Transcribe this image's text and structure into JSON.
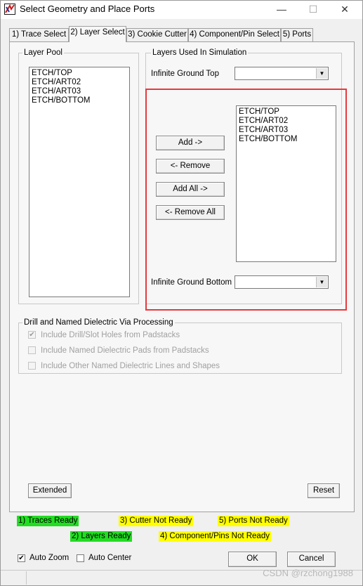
{
  "window": {
    "title": "Select Geometry and Place Ports"
  },
  "titlebar_buttons": {
    "minimize": "—",
    "maximize": "☐",
    "close": "✕"
  },
  "tabs": [
    {
      "label": "1) Trace Select"
    },
    {
      "label": "2) Layer Select"
    },
    {
      "label": "3) Cookie Cutter"
    },
    {
      "label": "4) Component/Pin Select"
    },
    {
      "label": "5) Ports"
    }
  ],
  "layer_pool": {
    "label": "Layer Pool",
    "items": [
      "ETCH/TOP",
      "ETCH/ART02",
      "ETCH/ART03",
      "ETCH/BOTTOM"
    ]
  },
  "layers_used": {
    "label": "Layers Used In Simulation",
    "ground_top_label": "Infinite Ground Top",
    "ground_top_value": "",
    "ground_bottom_label": "Infinite Ground Bottom",
    "ground_bottom_value": "",
    "items": [
      "ETCH/TOP",
      "ETCH/ART02",
      "ETCH/ART03",
      "ETCH/BOTTOM"
    ]
  },
  "buttons": {
    "add": "Add ->",
    "remove": "<- Remove",
    "add_all": "Add All ->",
    "remove_all": "<- Remove All",
    "extended": "Extended",
    "reset": "Reset",
    "ok": "OK",
    "cancel": "Cancel"
  },
  "drill_group": {
    "label": "Drill and Named Dielectric Via Processing",
    "options": [
      {
        "label": "Include Drill/Slot Holes from Padstacks",
        "checked": true
      },
      {
        "label": "Include Named Dielectric Pads from Padstacks",
        "checked": false
      },
      {
        "label": "Include Other Named Dielectric Lines and Shapes",
        "checked": false
      }
    ]
  },
  "status": {
    "traces": "1) Traces Ready",
    "layers": "2) Layers Ready",
    "cutter": "3) Cutter Not Ready",
    "components": "4) Component/Pins Not Ready",
    "ports": "5) Ports Not Ready"
  },
  "colors": {
    "ready": "#22dd22",
    "not_ready": "#ffff00",
    "highlight": "#e8383d"
  },
  "options": {
    "auto_zoom": {
      "label": "Auto Zoom",
      "checked": true
    },
    "auto_center": {
      "label": "Auto Center",
      "checked": false
    }
  },
  "watermark": "CSDN @rzchong1988"
}
